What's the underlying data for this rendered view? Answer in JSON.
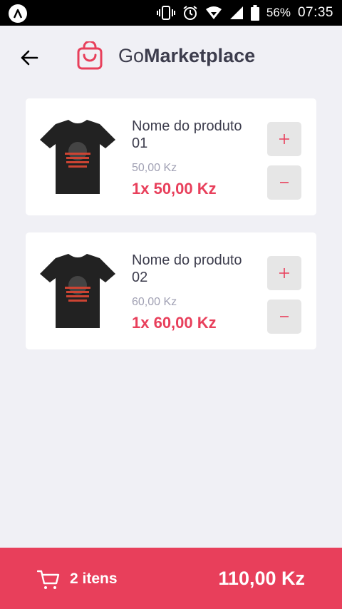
{
  "status_bar": {
    "battery": "56%",
    "time": "07:35",
    "icons": [
      "app-logo-icon",
      "vibrate-icon",
      "alarm-icon",
      "wifi-icon",
      "signal-icon",
      "battery-icon"
    ]
  },
  "header": {
    "brand_prefix": "Go",
    "brand_bold": "Marketplace",
    "icons": [
      "back-arrow-icon",
      "shopping-bag-icon"
    ]
  },
  "products": [
    {
      "name": "Nome do produto 01",
      "price": "50,00 Kz",
      "subtotal": "1x 50,00 Kz"
    },
    {
      "name": "Nome do produto 02",
      "price": "60,00 Kz",
      "subtotal": "1x 60,00 Kz"
    }
  ],
  "footer": {
    "items_label": "2 itens",
    "total": "110,00 Kz"
  },
  "colors": {
    "accent": "#e83f5b",
    "background": "#f0f0f5",
    "text": "#3d3d4d",
    "muted": "#a0a0b3",
    "button_bg": "#e6e6e6"
  }
}
